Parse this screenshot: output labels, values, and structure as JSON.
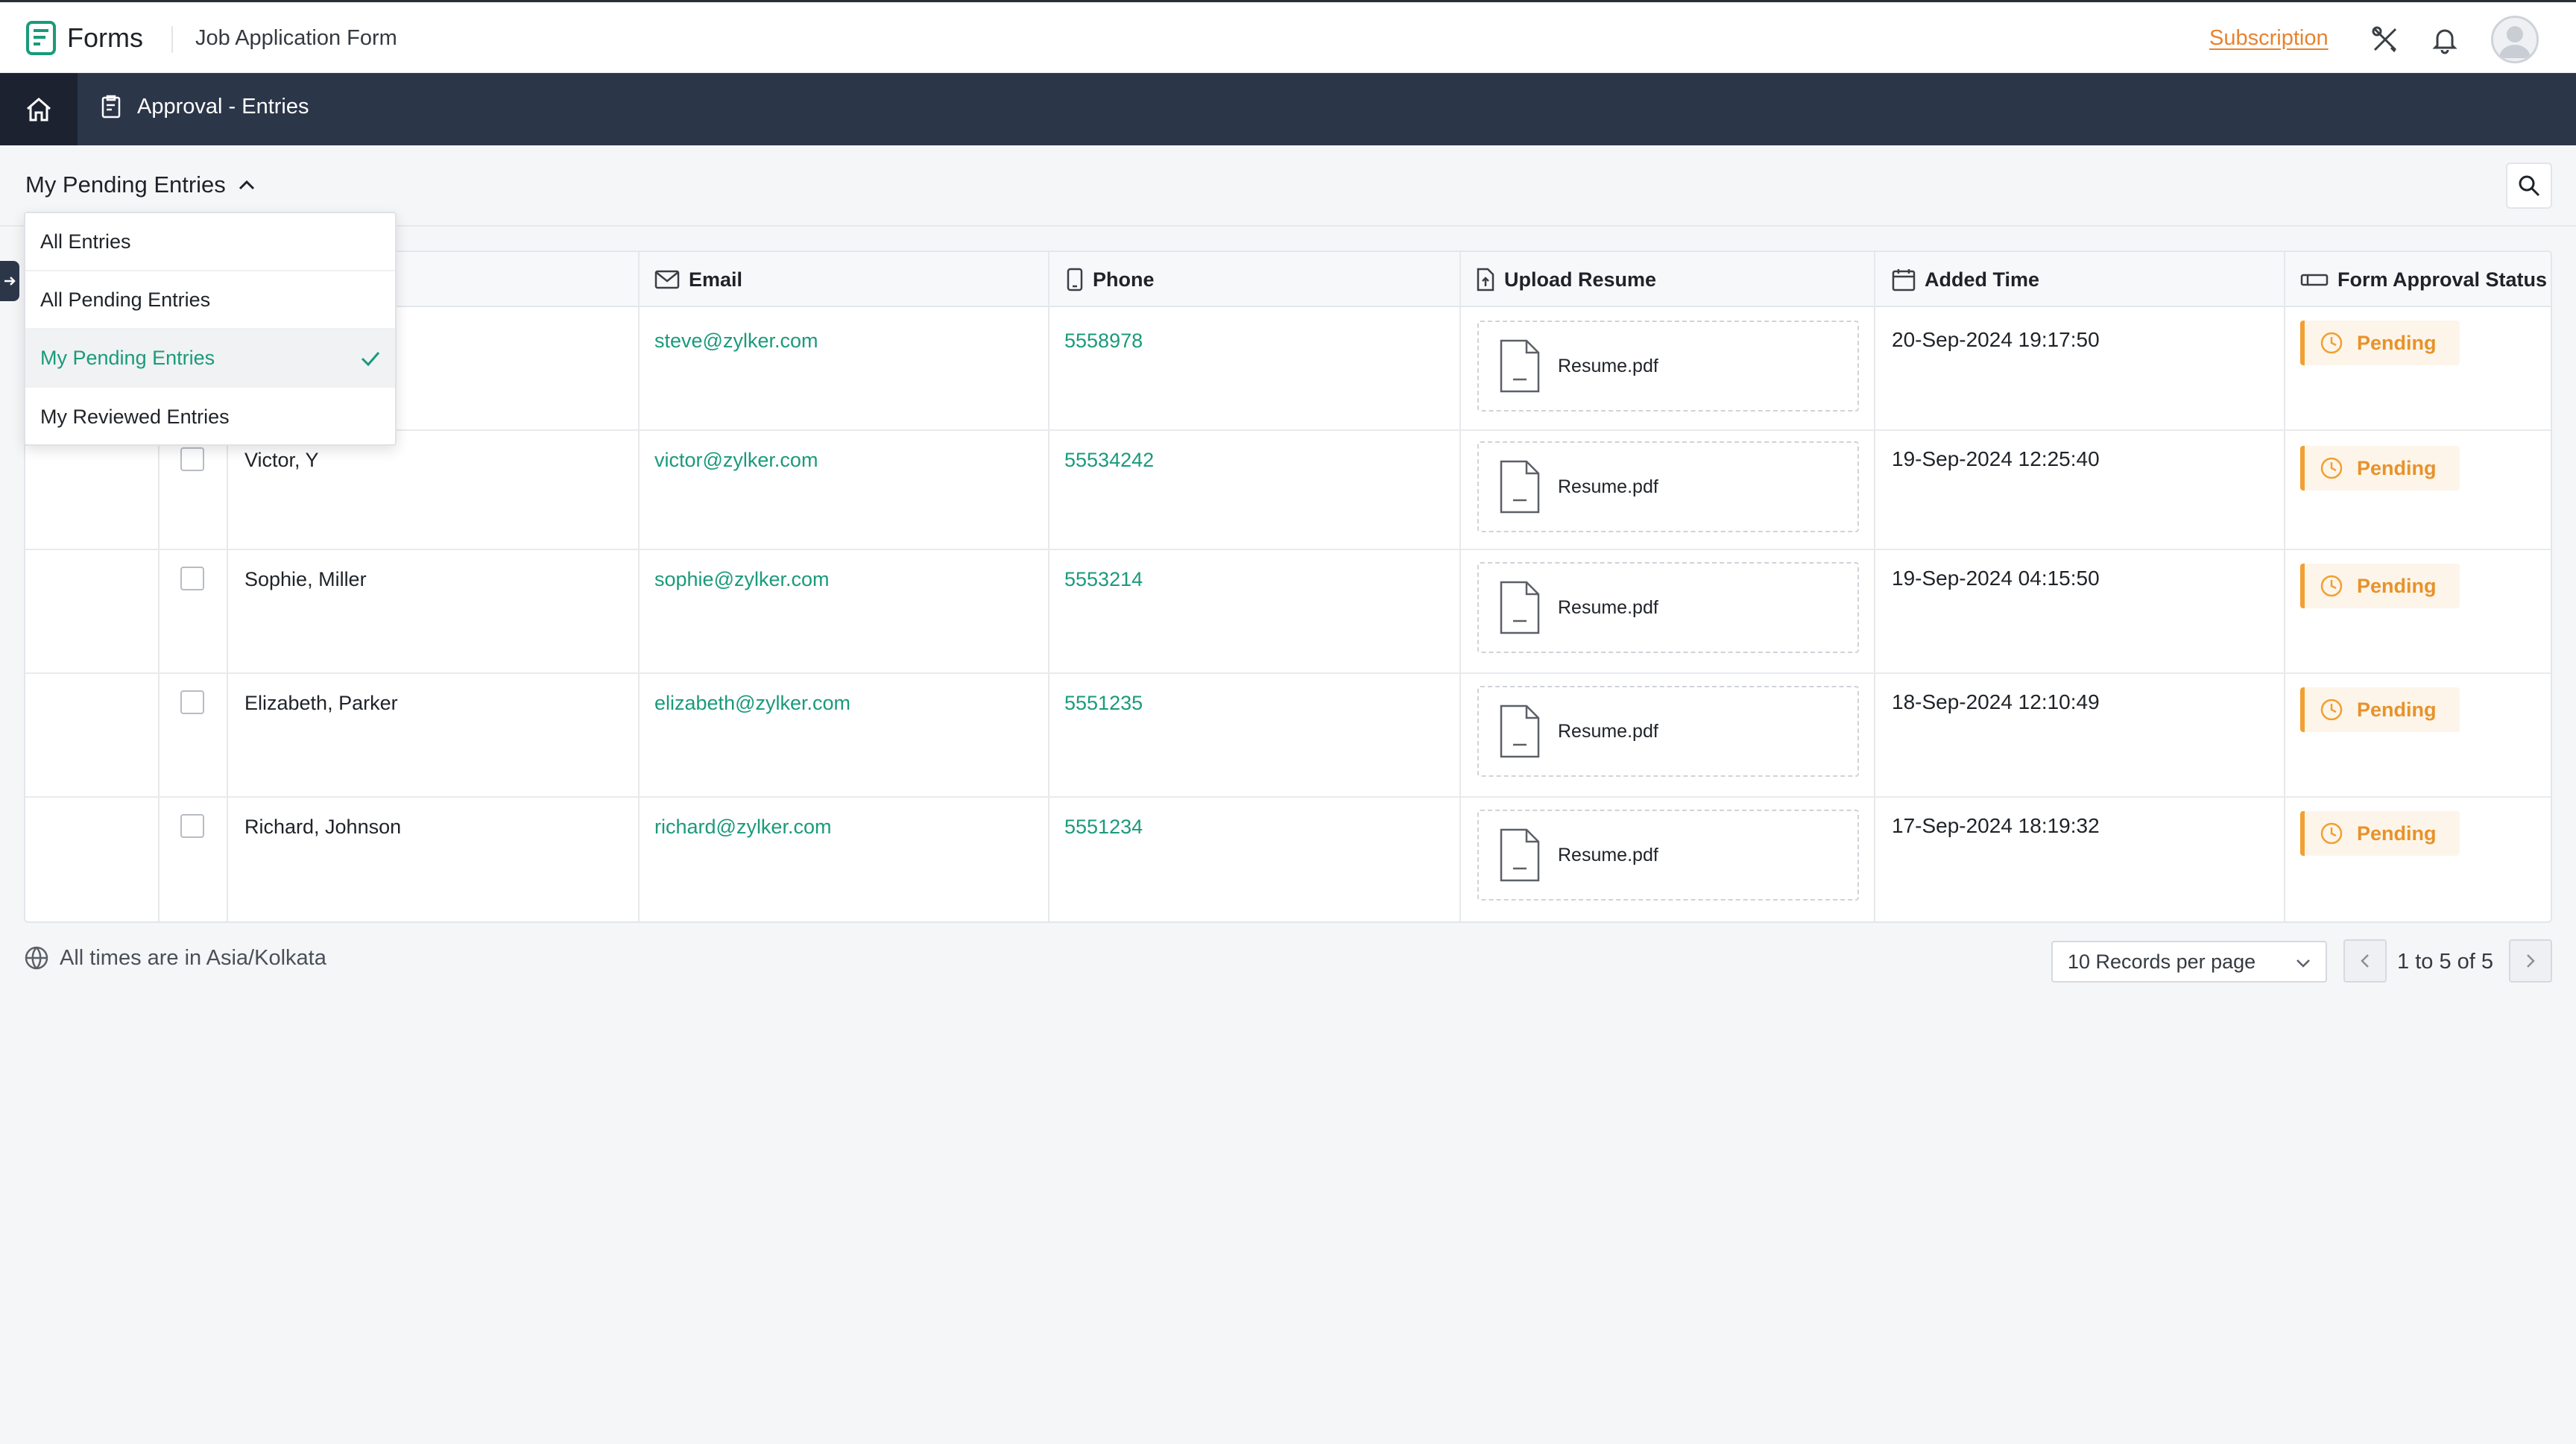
{
  "header": {
    "app_name": "Forms",
    "form_name": "Job Application Form",
    "subscription_label": "Subscription"
  },
  "navbar": {
    "tab_label": "Approval - Entries"
  },
  "filter": {
    "current": "My Pending Entries",
    "options": [
      "All Entries",
      "All Pending Entries",
      "My Pending Entries",
      "My Reviewed Entries"
    ],
    "selected_index": 2
  },
  "table": {
    "columns": [
      "Email",
      "Phone",
      "Upload Resume",
      "Added Time",
      "Form Approval Status"
    ],
    "rows": [
      {
        "name": "",
        "email": "steve@zylker.com",
        "phone": "5558978",
        "file": "Resume.pdf",
        "time": "20-Sep-2024 19:17:50",
        "status": "Pending"
      },
      {
        "name": "Victor, Y",
        "email": "victor@zylker.com",
        "phone": "55534242",
        "file": "Resume.pdf",
        "time": "19-Sep-2024 12:25:40",
        "status": "Pending"
      },
      {
        "name": "Sophie, Miller",
        "email": "sophie@zylker.com",
        "phone": "5553214",
        "file": "Resume.pdf",
        "time": "19-Sep-2024 04:15:50",
        "status": "Pending"
      },
      {
        "name": "Elizabeth, Parker",
        "email": "elizabeth@zylker.com",
        "phone": "5551235",
        "file": "Resume.pdf",
        "time": "18-Sep-2024 12:10:49",
        "status": "Pending"
      },
      {
        "name": "Richard, Johnson",
        "email": "richard@zylker.com",
        "phone": "5551234",
        "file": "Resume.pdf",
        "time": "17-Sep-2024 18:19:32",
        "status": "Pending"
      }
    ]
  },
  "footer": {
    "timezone_text": "All times are in Asia/Kolkata",
    "per_page_label": "10 Records per page",
    "range_from": "1",
    "range_to_word": "to",
    "range_to": "5",
    "range_of_word": "of",
    "range_total": "5"
  },
  "colors": {
    "accent_green": "#1a9a7b",
    "subscription_orange": "#e8822f",
    "pending_orange": "#f1a032",
    "navbar_bg": "#2c3649"
  }
}
